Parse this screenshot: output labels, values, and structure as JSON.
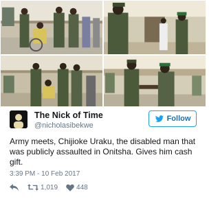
{
  "collage": {
    "photos": [
      "photo-1",
      "photo-2",
      "photo-3",
      "photo-4"
    ]
  },
  "user": {
    "display_name": "The Nick of Time",
    "handle": "@nicholasibekwe"
  },
  "follow_button": {
    "label": "Follow",
    "icon": "bird-icon"
  },
  "tweet": {
    "text": "Army meets, Chijioke Uraku, the disabled man that was publicly assaulted in Onitsha. Gives him cash gift.",
    "timestamp": "3:39 PM - 10 Feb 2017"
  },
  "actions": {
    "reply_icon": "reply-icon",
    "retweet_icon": "retweet-icon",
    "retweet_count": "1,019",
    "like_icon": "heart-icon",
    "like_count": "448"
  },
  "colors": {
    "accent": "#1da1f2",
    "text": "#14171a",
    "muted": "#657786"
  }
}
